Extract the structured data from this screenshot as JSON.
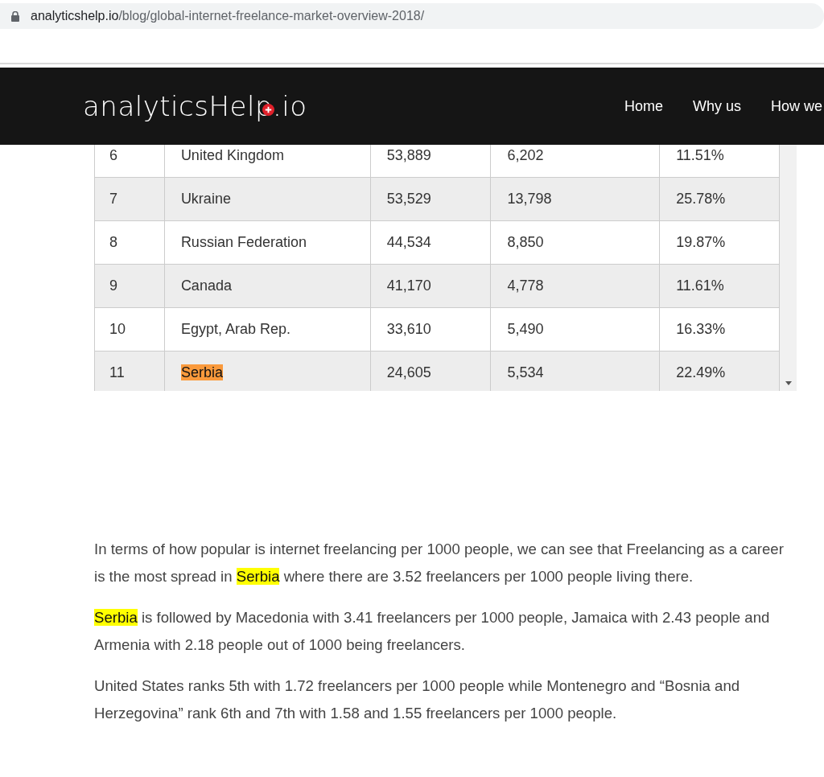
{
  "address_bar": {
    "domain": "analyticshelp.io",
    "path": "/blog/global-internet-freelance-market-overview-2018/"
  },
  "header": {
    "logo": "analyticsHelp.io",
    "nav": [
      "Home",
      "Why us",
      "How we"
    ]
  },
  "table": {
    "rows": [
      {
        "cells": [
          {
            "text": "6",
            "highlight": false
          },
          {
            "text": "United Kingdom",
            "highlight": false
          },
          {
            "text": "53,889",
            "highlight": false
          },
          {
            "text": "6,202",
            "highlight": false
          },
          {
            "text": "11.51%",
            "highlight": false
          }
        ]
      },
      {
        "cells": [
          {
            "text": "7",
            "highlight": false
          },
          {
            "text": "Ukraine",
            "highlight": false
          },
          {
            "text": "53,529",
            "highlight": false
          },
          {
            "text": "13,798",
            "highlight": false
          },
          {
            "text": "25.78%",
            "highlight": false
          }
        ]
      },
      {
        "cells": [
          {
            "text": "8",
            "highlight": false
          },
          {
            "text": "Russian Federation",
            "highlight": false
          },
          {
            "text": "44,534",
            "highlight": false
          },
          {
            "text": "8,850",
            "highlight": false
          },
          {
            "text": "19.87%",
            "highlight": false
          }
        ]
      },
      {
        "cells": [
          {
            "text": "9",
            "highlight": false
          },
          {
            "text": "Canada",
            "highlight": false
          },
          {
            "text": "41,170",
            "highlight": false
          },
          {
            "text": "4,778",
            "highlight": false
          },
          {
            "text": "11.61%",
            "highlight": false
          }
        ]
      },
      {
        "cells": [
          {
            "text": "10",
            "highlight": false
          },
          {
            "text": "Egypt, Arab Rep.",
            "highlight": false
          },
          {
            "text": "33,610",
            "highlight": false
          },
          {
            "text": "5,490",
            "highlight": false
          },
          {
            "text": "16.33%",
            "highlight": false
          }
        ]
      },
      {
        "cells": [
          {
            "text": "11",
            "highlight": false
          },
          {
            "text": "Serbia",
            "highlight": true
          },
          {
            "text": "24,605",
            "highlight": false
          },
          {
            "text": "5,534",
            "highlight": false
          },
          {
            "text": "22.49%",
            "highlight": false
          }
        ]
      }
    ]
  },
  "paragraphs": [
    {
      "segments": [
        {
          "text": "In terms of how popular is internet freelancing per 1000 people, we can see that Freelancing as a career is the most spread in ",
          "highlight": false
        },
        {
          "text": "Serbia",
          "highlight": true
        },
        {
          "text": " where there are 3.52 freelancers per 1000 people living there.",
          "highlight": false
        }
      ]
    },
    {
      "segments": [
        {
          "text": "Serbia",
          "highlight": true
        },
        {
          "text": " is followed by Macedonia with 3.41 freelancers per 1000 people, Jamaica with 2.43 people and Armenia with 2.18 people out of 1000 being freelancers.",
          "highlight": false
        }
      ]
    },
    {
      "segments": [
        {
          "text": "United States ranks 5th with 1.72 freelancers per 1000 people while Montenegro and “Bosnia and Herzegovina” rank 6th and 7th with 1.58 and 1.55 freelancers per 1000 people.",
          "highlight": false
        }
      ]
    }
  ]
}
